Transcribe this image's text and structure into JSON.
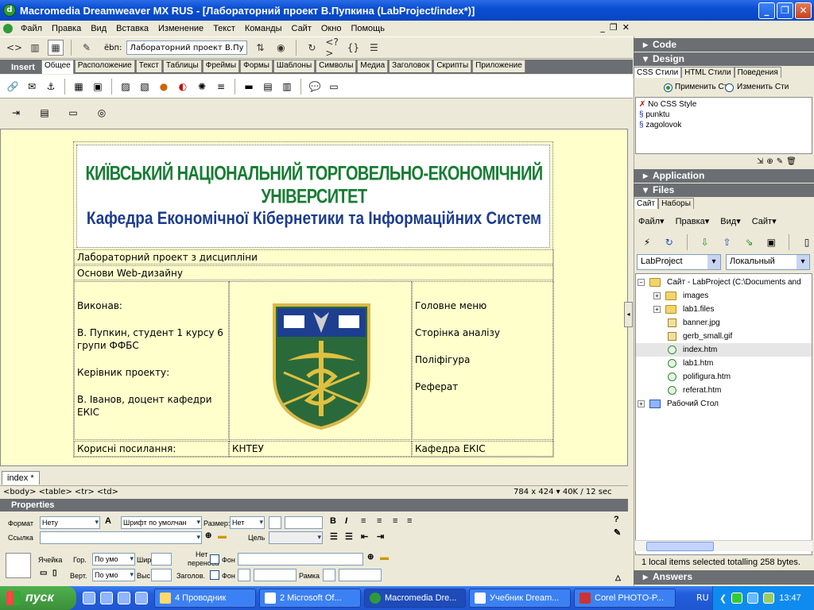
{
  "window": {
    "title": "Macromedia Dreamweaver MX RUS - [Лабораторний проект В.Пупкина (LabProject/index*)]"
  },
  "menu": [
    "Файл",
    "Правка",
    "Вид",
    "Вставка",
    "Изменение",
    "Текст",
    "Команды",
    "Сайт",
    "Окно",
    "Помощь"
  ],
  "doc_toolbar": {
    "title_label": "ёbп:",
    "title_value": "Лабораторний проект В.Пупк"
  },
  "insert": {
    "title": "Insert",
    "tabs": [
      "Общее",
      "Расположение",
      "Текст",
      "Таблицы",
      "Фреймы",
      "Формы",
      "Шаблоны",
      "Символы",
      "Медиа",
      "Заголовок",
      "Скрипты",
      "Приложение"
    ]
  },
  "page": {
    "banner_line1": "КИЇВСЬКИЙ НАЦІОНАЛЬНИЙ ТОРГОВЕЛЬНО-ЕКОНОМІЧНИЙ УНІВЕРСИТЕТ",
    "banner_line2": "Кафедра Економічної Кібернетики та Інформаційних Систем",
    "row1": "Лабораторний проект з дисципліни",
    "row2": "Основи Web-дизайну",
    "left": {
      "p1": "Виконав:",
      "p2": "В. Пупкин, студент 1 курсу 6 групи ФФБС",
      "p3": "Керівник проекту:",
      "p4": "В. Іванов, доцент кафедри ЕКІС"
    },
    "menu": [
      "Головне меню",
      "Сторінка аналізу",
      "Поліфігура",
      "Реферат"
    ],
    "footer": [
      "Корисні посилання:",
      "КНТЕУ",
      "Кафедра ЕКІС"
    ]
  },
  "doc_tab": "index",
  "status": {
    "tags": "<body> <table> <tr> <td>",
    "dims": "784 x 424 ▾ 40K / 12 sec"
  },
  "properties": {
    "title": "Properties",
    "format_label": "Формат",
    "format_value": "Нету",
    "font_value": "Шрифт по умолчан",
    "size_label": "Размер:",
    "size_value": "Нет",
    "link_label": "Ссылка",
    "target_label": "Цель",
    "cell_label": "Ячейка",
    "horz_label": "Гор.",
    "horz_value": "По умо",
    "vert_label": "Верт.",
    "vert_value": "По умо",
    "width_label": "Шир",
    "height_label": "Выс",
    "nowrap_label1": "Нет",
    "nowrap_label2": "переноса",
    "header_label": "Заголов.",
    "bg_label": "Фон",
    "border_label": "Рамка"
  },
  "right": {
    "code": "Code",
    "design": "Design",
    "css_tabs": [
      "CSS Стили",
      "HTML Стили",
      "Поведения"
    ],
    "apply": "Применить Ст",
    "edit": "Изменить Сти",
    "styles": [
      "No CSS Style",
      "punktu",
      "zagolovok"
    ],
    "application": "Application",
    "files": "Files",
    "files_tabs": [
      "Сайт",
      "Наборы"
    ],
    "files_menu": [
      "Файл",
      "Правка",
      "Вид",
      "Сайт"
    ],
    "site_select": "LabProject",
    "view_select": "Локальный",
    "tree": {
      "root": "Сайт - LabProject (C:\\Documents and",
      "items": [
        "images",
        "lab1.files",
        "banner.jpg",
        "gerb_small.gif",
        "index.htm",
        "lab1.htm",
        "polifigura.htm",
        "referat.htm"
      ],
      "desktop": "Рабочий Стол"
    },
    "status": "1 local items selected totalling 258 bytes.",
    "answers": "Answers"
  },
  "taskbar": {
    "start": "пуск",
    "tasks": [
      "4 Проводник",
      "2 Microsoft Of...",
      "Macromedia Dre...",
      "Учебник Dream...",
      "Corel PHOTO-P..."
    ],
    "lang": "RU",
    "clock": "13:47"
  }
}
